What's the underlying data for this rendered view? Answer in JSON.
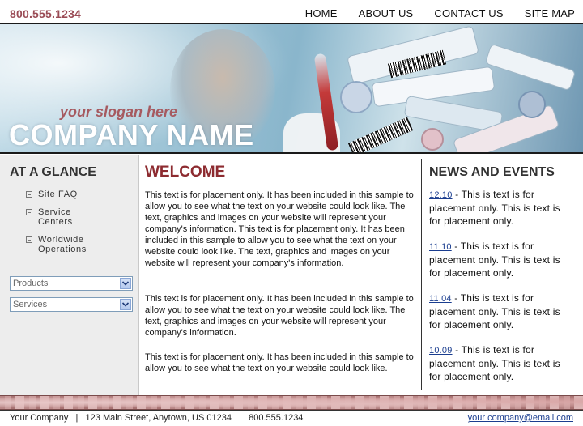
{
  "header": {
    "phone": "800.555.1234",
    "nav": [
      "HOME",
      "ABOUT US",
      "CONTACT US",
      "SITE MAP"
    ]
  },
  "banner": {
    "slogan": "your slogan here",
    "company_name": "COMPANY NAME"
  },
  "sidebar": {
    "title": "AT A GLANCE",
    "items": [
      {
        "label": "Site FAQ"
      },
      {
        "label": "Service Centers"
      },
      {
        "label": "Worldwide Operations"
      }
    ],
    "selects": [
      {
        "value": "Products"
      },
      {
        "value": "Services"
      }
    ]
  },
  "main": {
    "title": "WELCOME",
    "paragraphs": [
      "This text is for placement only. It has been included in this sample to allow you to see what the text on your website could look like. The text, graphics and images on your website will represent your company's information. This text is for placement only. It has been included in this sample to allow you to see what the text on your website could look like. The text, graphics and images on your website will represent your company's information.",
      "This text is for placement only. It has been included in this sample to allow you to see what the text on your website could look like. The text, graphics and images on your website will represent your company's information.",
      "This text is for placement only. It has been included in this sample to allow you to see what the text on your website could look like."
    ]
  },
  "news": {
    "title": "NEWS AND EVENTS",
    "items": [
      {
        "date": "12.10",
        "text": " - This is text is for placement only. This is text is for placement only."
      },
      {
        "date": "11.10",
        "text": " - This is text is for placement only. This is text is for placement only."
      },
      {
        "date": "11.04",
        "text": " - This is text is for placement only. This is text is for placement only."
      },
      {
        "date": "10.09",
        "text": " - This is text is for placement only. This is text is for placement only."
      }
    ]
  },
  "footer": {
    "info": "Your Company   |   123 Main Street, Anytown, US 01234   |   800.555.1234",
    "email": "your company@email.com"
  },
  "colors": {
    "accent": "#8d2b30",
    "phone": "#9a4b55",
    "link": "#1a3d8f"
  }
}
